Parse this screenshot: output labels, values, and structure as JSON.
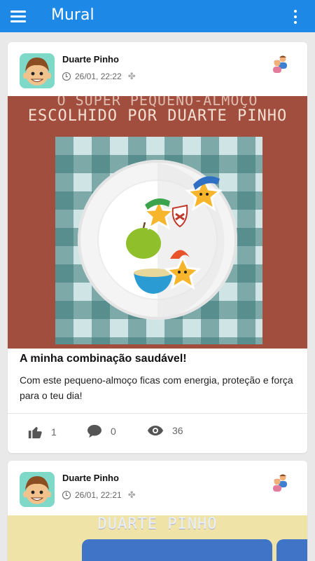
{
  "appbar": {
    "title": "Mural"
  },
  "posts": [
    {
      "author": "Duarte Pinho",
      "timestamp": "26/01, 22:22",
      "image_caption_line1": "O SUPER PEQUENO-ALMOÇO",
      "image_caption_line2": "ESCOLHIDO POR DUARTE PINHO",
      "title": "A minha combinação saudável!",
      "text": "Com este pequeno-almoço ficas com energia, proteção e força para o teu dia!",
      "likes": "1",
      "comments": "0",
      "views": "36"
    },
    {
      "author": "Duarte Pinho",
      "timestamp": "26/01, 22:21",
      "image_caption_line2": "DUARTE PINHO"
    }
  ],
  "colors": {
    "appbar": "#1d88e5",
    "background": "#e9e9ea",
    "card_image_bg": "#a14e3f"
  },
  "icons": [
    "menu-icon",
    "more-vert-icon",
    "clock-icon",
    "puzzle-icon",
    "share-users-icon",
    "thumbs-up-icon",
    "comment-icon",
    "eye-icon"
  ]
}
